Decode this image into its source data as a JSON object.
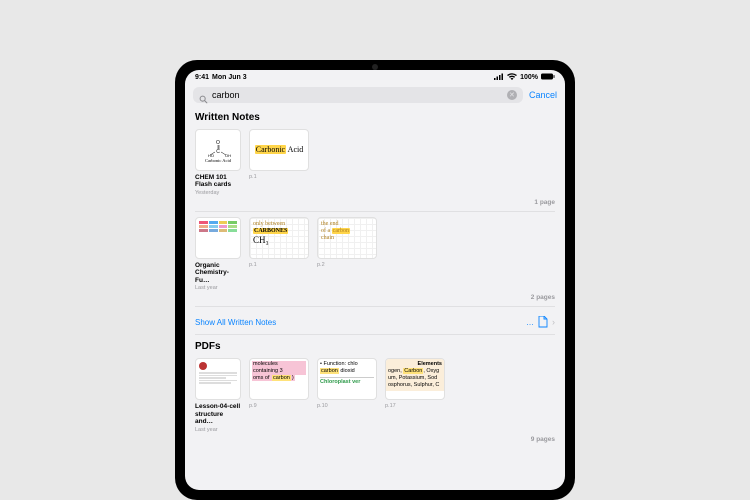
{
  "statusbar": {
    "time": "9:41",
    "date": "Mon Jun 3",
    "signal_label": "signal",
    "wifi_label": "wifi",
    "battery_pct": "100%"
  },
  "search": {
    "value": "carbon",
    "cancel_label": "Cancel"
  },
  "sections": {
    "written_notes": {
      "title": "Written Notes",
      "show_all_label": "Show All Written Notes",
      "items": [
        {
          "title": "CHEM 101 Flash cards",
          "subtitle": "Yesterday",
          "page_count_label": "1 page",
          "pages": [
            {
              "ind": "",
              "content_type": "molecule",
              "caption": "Carbonic Acid"
            },
            {
              "ind": "p.1",
              "content_type": "handwriting",
              "text": "Carbonic Acid",
              "highlight": "Carbonic"
            }
          ]
        },
        {
          "title": "Organic Chemistry- Fu…",
          "subtitle": "Last year",
          "page_count_label": "2 pages",
          "pages": [
            {
              "ind": "",
              "content_type": "color-table"
            },
            {
              "ind": "p.1",
              "content_type": "handwriting-grid",
              "line1_pre": "only between",
              "line1_hl": "CARBONES",
              "line2": "CH₃"
            },
            {
              "ind": "p.2",
              "content_type": "handwriting-grid",
              "line1": "the end",
              "line2_pre": "of a ",
              "line2_hl": "carbon",
              "line3": "chain"
            }
          ]
        }
      ]
    },
    "pdfs": {
      "title": "PDFs",
      "items": [
        {
          "title": "Lesson-04-cell structure and…",
          "subtitle": "Last year",
          "page_count_label": "9 pages",
          "pages": [
            {
              "ind": "",
              "content_type": "pdf-cover"
            },
            {
              "ind": "p.9",
              "content_type": "pdf-text",
              "line1": "molecules",
              "line2_pre": "containing 3",
              "line3_pre": "oms of ",
              "line3_hl": "carbon",
              "line3_post": ")"
            },
            {
              "ind": "p.10",
              "content_type": "pdf-text",
              "line1": "• Function: chlo",
              "line2_hl": "carbon",
              "line2_post": " dioxid",
              "line3_green": "Chloroplast ver"
            },
            {
              "ind": "p.17",
              "content_type": "pdf-text",
              "heading": "Elements",
              "line1_pre": "ogen, ",
              "line1_hl": "Carbon",
              "line1_post": ", Oxyg",
              "line2": "um, Potassium, Sod",
              "line3": "osphorus, Sulphur, C"
            }
          ]
        }
      ]
    }
  }
}
